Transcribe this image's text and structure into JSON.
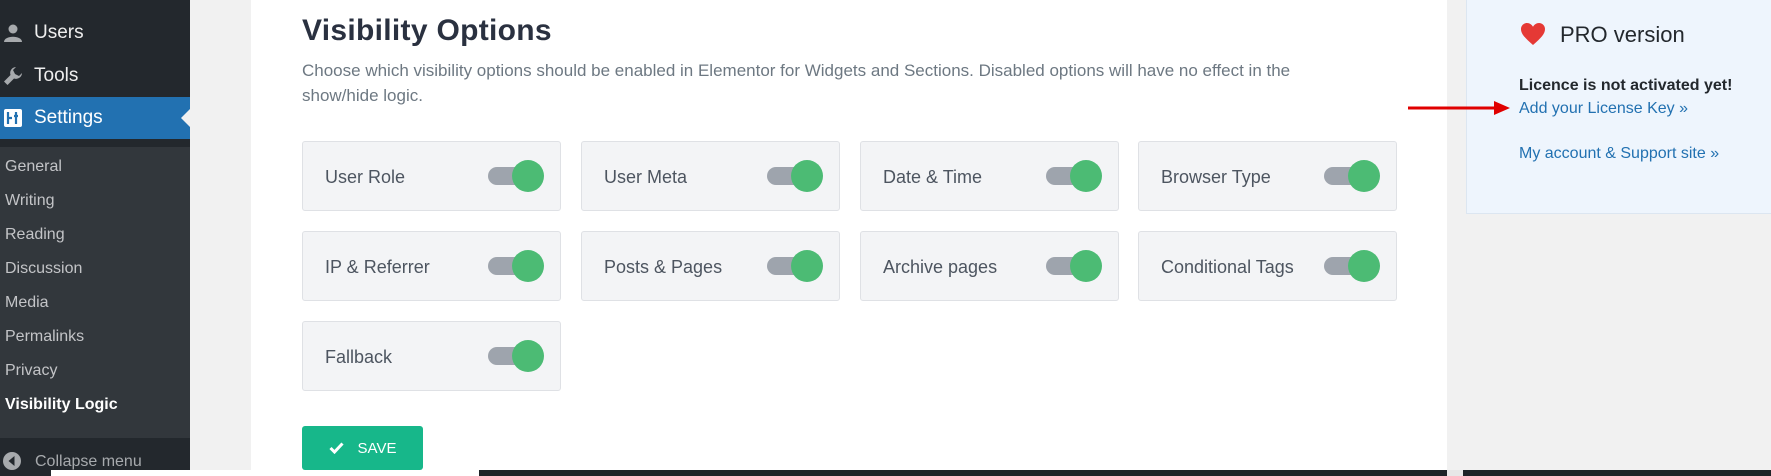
{
  "sidebar": {
    "top_items": [
      {
        "label": "Users",
        "icon": "users-icon"
      },
      {
        "label": "Tools",
        "icon": "wrench-icon"
      },
      {
        "label": "Settings",
        "icon": "settings-icon"
      }
    ],
    "submenu": [
      "General",
      "Writing",
      "Reading",
      "Discussion",
      "Media",
      "Permalinks",
      "Privacy",
      "Visibility Logic"
    ],
    "current_submenu": "Visibility Logic",
    "collapse_label": "Collapse menu"
  },
  "main": {
    "title": "Visibility Options",
    "description": "Choose which visibility options should be enabled in Elementor for Widgets and Sections. Disabled options will have no effect in the show/hide logic.",
    "options": [
      {
        "label": "User Role",
        "enabled": true
      },
      {
        "label": "User Meta",
        "enabled": true
      },
      {
        "label": "Date & Time",
        "enabled": true
      },
      {
        "label": "Browser Type",
        "enabled": true
      },
      {
        "label": "IP & Referrer",
        "enabled": true
      },
      {
        "label": "Posts & Pages",
        "enabled": true
      },
      {
        "label": "Archive pages",
        "enabled": true
      },
      {
        "label": "Conditional Tags",
        "enabled": true
      },
      {
        "label": "Fallback",
        "enabled": true
      }
    ],
    "save_label": "SAVE"
  },
  "pro": {
    "title": "PRO version",
    "licence_message": "Licence is not activated yet!",
    "license_link": "Add your License Key »",
    "support_link": "My account & Support site »"
  },
  "colors": {
    "sidebar_bg": "#23282d",
    "accent_blue": "#2271b1",
    "toggle_on": "#4cbb74",
    "save_button": "#17b78a",
    "heart": "#e53935",
    "arrow": "#e00000"
  }
}
